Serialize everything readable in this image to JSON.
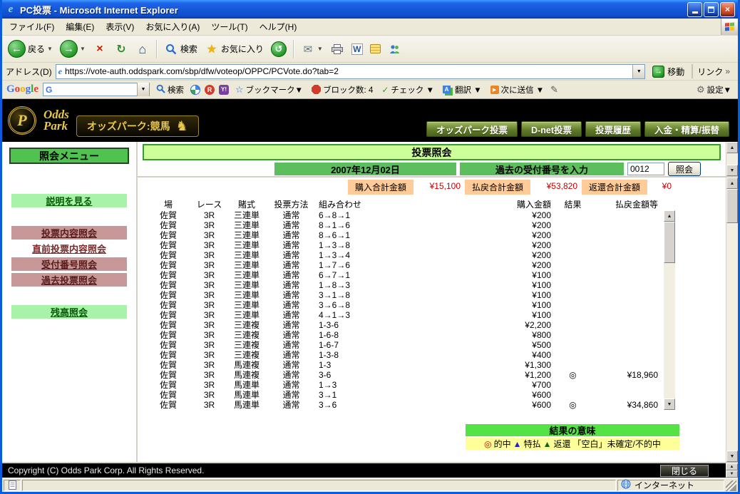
{
  "window": {
    "title": "PC投票 - Microsoft Internet Explorer"
  },
  "menubar": {
    "items": [
      "ファイル(F)",
      "編集(E)",
      "表示(V)",
      "お気に入り(A)",
      "ツール(T)",
      "ヘルプ(H)"
    ]
  },
  "toolbar": {
    "back": "戻る",
    "search": "検索",
    "favorites": "お気に入り"
  },
  "addressbar": {
    "label": "アドレス(D)",
    "url": "https://vote-auth.oddspark.com/sbp/dfw/voteop/OPPC/PCVote.do?tab=2",
    "go": "移動",
    "links": "リンク"
  },
  "google_toolbar": {
    "logo": "Google",
    "logo_colors": [
      "#4274F0",
      "#E23A2E",
      "#F4B400",
      "#4274F0",
      "#36A852",
      "#E23A2E"
    ],
    "search": "検索",
    "badge_r": "R",
    "badge_y": "Y!",
    "bookmarks": "ブックマーク▼",
    "blocked": "ブロック数: 4",
    "check": "チェック ▼",
    "translate": "翻訳 ▼",
    "send": "次に送信 ▼",
    "settings": "設定▼"
  },
  "site_header": {
    "emblem": "P",
    "brand_line1": "Odds",
    "brand_line2": "Park",
    "tagline": "オッズパーク:競馬",
    "nav": [
      "オッズパーク投票",
      "D-net投票",
      "投票履歴",
      "入金・精算/振替"
    ]
  },
  "sidebar": {
    "title": "照会メニュー",
    "items": [
      {
        "label": "説明を見る",
        "name": "explain",
        "style": "green",
        "gap": "lg"
      },
      {
        "label": "投票内容照会",
        "name": "vote-content",
        "style": "pink",
        "gap": "md"
      },
      {
        "label": "直前投票内容照会",
        "name": "last-vote-content",
        "style": "plain",
        "gap": "none"
      },
      {
        "label": "受付番号照会",
        "name": "receipt-number",
        "style": "pink",
        "gap": "none"
      },
      {
        "label": "過去投票照会",
        "name": "past-votes",
        "style": "pink",
        "gap": "none"
      },
      {
        "label": "残高照会",
        "name": "balance",
        "style": "green",
        "gap": "md"
      }
    ]
  },
  "main": {
    "title": "投票照会",
    "date": "2007年12月02日",
    "receipt_label": "過去の受付番号を入力",
    "receipt_value": "0012",
    "inquiry_button": "照会",
    "summary": [
      {
        "label": "購入合計金額",
        "value": "¥15,100"
      },
      {
        "label": "払戻合計金額",
        "value": "¥53,820"
      },
      {
        "label": "返還合計金額",
        "value": "¥0"
      }
    ],
    "table": {
      "headers": [
        "場",
        "レース",
        "賭式",
        "投票方法",
        "組み合わせ",
        "購入金額",
        "結果",
        "払戻金額等"
      ],
      "rows": [
        [
          "佐賀",
          "3R",
          "三連単",
          "通常",
          "6→8→1",
          "¥200",
          "",
          ""
        ],
        [
          "佐賀",
          "3R",
          "三連単",
          "通常",
          "8→1→6",
          "¥200",
          "",
          ""
        ],
        [
          "佐賀",
          "3R",
          "三連単",
          "通常",
          "8→6→1",
          "¥200",
          "",
          ""
        ],
        [
          "佐賀",
          "3R",
          "三連単",
          "通常",
          "1→3→8",
          "¥200",
          "",
          ""
        ],
        [
          "佐賀",
          "3R",
          "三連単",
          "通常",
          "1→3→4",
          "¥200",
          "",
          ""
        ],
        [
          "佐賀",
          "3R",
          "三連単",
          "通常",
          "1→7→6",
          "¥200",
          "",
          ""
        ],
        [
          "佐賀",
          "3R",
          "三連単",
          "通常",
          "6→7→1",
          "¥100",
          "",
          ""
        ],
        [
          "佐賀",
          "3R",
          "三連単",
          "通常",
          "1→8→3",
          "¥100",
          "",
          ""
        ],
        [
          "佐賀",
          "3R",
          "三連単",
          "通常",
          "3→1→8",
          "¥100",
          "",
          ""
        ],
        [
          "佐賀",
          "3R",
          "三連単",
          "通常",
          "3→6→8",
          "¥100",
          "",
          ""
        ],
        [
          "佐賀",
          "3R",
          "三連単",
          "通常",
          "4→1→3",
          "¥100",
          "",
          ""
        ],
        [
          "佐賀",
          "3R",
          "三連複",
          "通常",
          "1-3-6",
          "¥2,200",
          "",
          ""
        ],
        [
          "佐賀",
          "3R",
          "三連複",
          "通常",
          "1-6-8",
          "¥800",
          "",
          ""
        ],
        [
          "佐賀",
          "3R",
          "三連複",
          "通常",
          "1-6-7",
          "¥500",
          "",
          ""
        ],
        [
          "佐賀",
          "3R",
          "三連複",
          "通常",
          "1-3-8",
          "¥400",
          "",
          ""
        ],
        [
          "佐賀",
          "3R",
          "馬連複",
          "通常",
          "1-3",
          "¥1,300",
          "",
          ""
        ],
        [
          "佐賀",
          "3R",
          "馬連複",
          "通常",
          "3-6",
          "¥1,200",
          "◎",
          "¥18,960"
        ],
        [
          "佐賀",
          "3R",
          "馬連単",
          "通常",
          "1→3",
          "¥700",
          "",
          ""
        ],
        [
          "佐賀",
          "3R",
          "馬連単",
          "通常",
          "3→1",
          "¥600",
          "",
          ""
        ],
        [
          "佐賀",
          "3R",
          "馬連単",
          "通常",
          "3→6",
          "¥600",
          "◎",
          "¥34,860"
        ]
      ]
    },
    "legend": {
      "title": "結果の意味",
      "items": [
        {
          "symbol": "◎",
          "color": "#CC0000",
          "label": "的中"
        },
        {
          "symbol": "▲",
          "color": "#2222CC",
          "label": "特払"
        },
        {
          "symbol": "▲",
          "color": "#116611",
          "label": "返還"
        },
        {
          "symbol": "",
          "color": "#000000",
          "label": "「空白」未確定/不的中"
        }
      ]
    }
  },
  "footer": {
    "copyright": "Copyright (C) Odds Park Corp. All Rights Reserved.",
    "close_button": "閉じる"
  },
  "statusbar": {
    "zone": "インターネット"
  }
}
